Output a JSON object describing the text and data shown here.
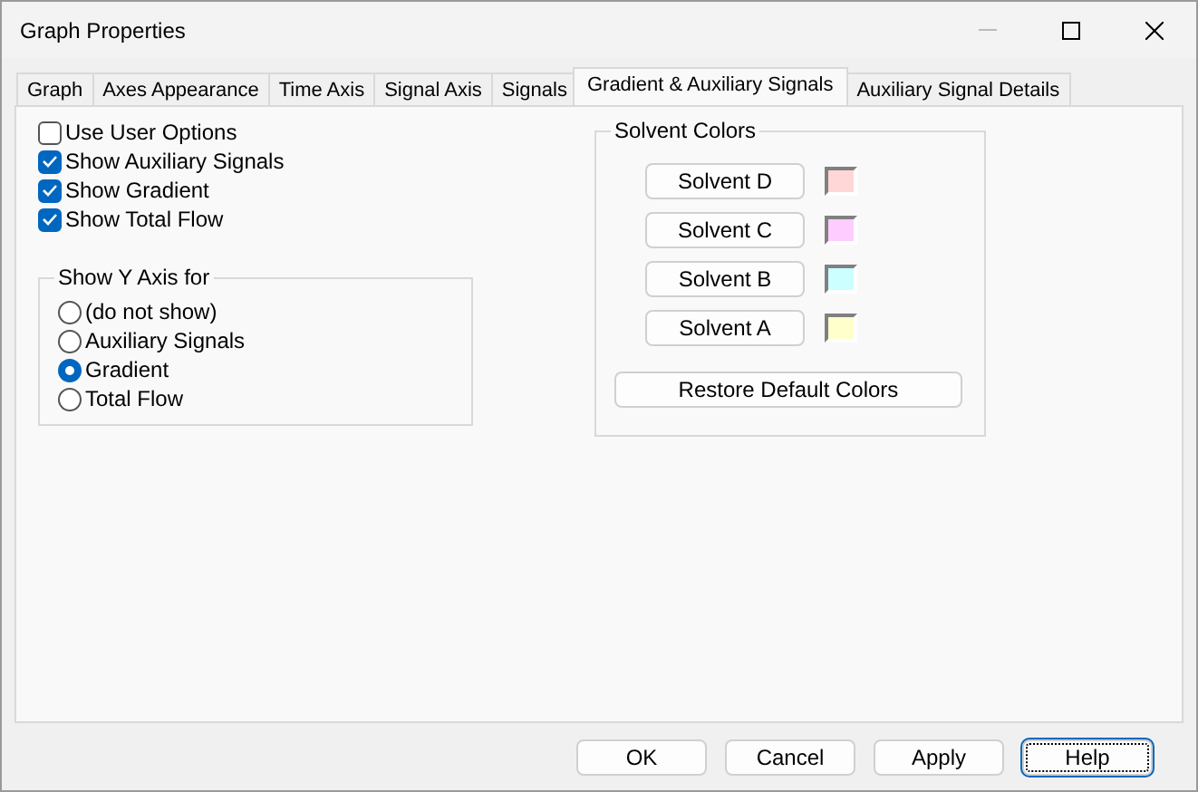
{
  "window": {
    "title": "Graph Properties"
  },
  "tabs": [
    {
      "label": "Graph",
      "selected": false
    },
    {
      "label": "Axes Appearance",
      "selected": false
    },
    {
      "label": "Time Axis",
      "selected": false
    },
    {
      "label": "Signal Axis",
      "selected": false
    },
    {
      "label": "Signals",
      "selected": false
    },
    {
      "label": "Gradient & Auxiliary Signals",
      "selected": true
    },
    {
      "label": "Auxiliary Signal Details",
      "selected": false
    }
  ],
  "options": [
    {
      "label": "Use User Options",
      "checked": false
    },
    {
      "label": "Show Auxiliary Signals",
      "checked": true
    },
    {
      "label": "Show Gradient",
      "checked": true
    },
    {
      "label": "Show Total Flow",
      "checked": true
    }
  ],
  "y_axis_group": {
    "title": "Show Y Axis for",
    "choices": [
      {
        "label": "(do not show)",
        "selected": false
      },
      {
        "label": "Auxiliary Signals",
        "selected": false
      },
      {
        "label": "Gradient",
        "selected": true
      },
      {
        "label": "Total Flow",
        "selected": false
      }
    ]
  },
  "solvent_colors": {
    "title": "Solvent Colors",
    "solvents": [
      {
        "label": "Solvent D",
        "color": "#ffd7d7"
      },
      {
        "label": "Solvent C",
        "color": "#ffccff"
      },
      {
        "label": "Solvent B",
        "color": "#ccffff"
      },
      {
        "label": "Solvent A",
        "color": "#ffffcc"
      }
    ],
    "restore_button": {
      "label": "Restore Default Colors"
    }
  },
  "buttons": [
    {
      "label": "OK",
      "focused": false
    },
    {
      "label": "Cancel",
      "focused": false
    },
    {
      "label": "Apply",
      "focused": false
    },
    {
      "label": "Help",
      "focused": true
    }
  ]
}
